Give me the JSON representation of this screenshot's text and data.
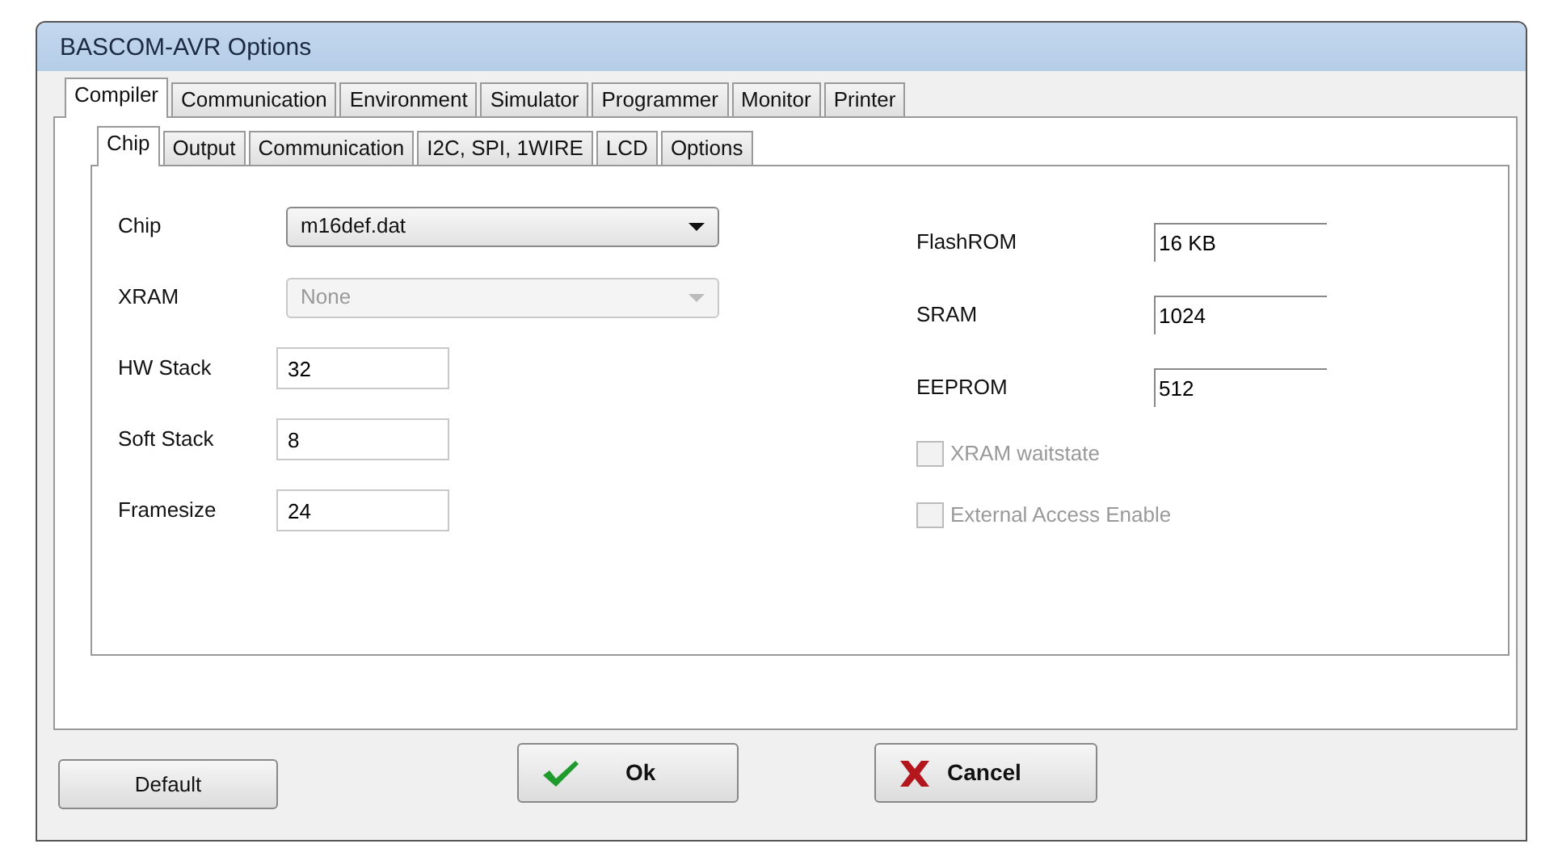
{
  "window": {
    "title": "BASCOM-AVR Options"
  },
  "tabs": [
    {
      "label": "Compiler",
      "selected": true
    },
    {
      "label": "Communication",
      "selected": false
    },
    {
      "label": "Environment",
      "selected": false
    },
    {
      "label": "Simulator",
      "selected": false
    },
    {
      "label": "Programmer",
      "selected": false
    },
    {
      "label": "Monitor",
      "selected": false
    },
    {
      "label": "Printer",
      "selected": false
    }
  ],
  "subtabs": [
    {
      "label": "Chip",
      "selected": true
    },
    {
      "label": "Output",
      "selected": false
    },
    {
      "label": "Communication",
      "selected": false
    },
    {
      "label": "I2C, SPI, 1WIRE",
      "selected": false
    },
    {
      "label": "LCD",
      "selected": false
    },
    {
      "label": "Options",
      "selected": false
    }
  ],
  "left_fields": [
    {
      "kind": "combo",
      "label": "Chip",
      "value": "m16def.dat",
      "disabled": false
    },
    {
      "kind": "combo",
      "label": "XRAM",
      "value": "None",
      "disabled": true
    },
    {
      "kind": "text",
      "label": "HW Stack",
      "value": "32"
    },
    {
      "kind": "text",
      "label": "Soft Stack",
      "value": "8"
    },
    {
      "kind": "text",
      "label": "Framesize",
      "value": "24"
    }
  ],
  "right_fields": [
    {
      "label": "FlashROM",
      "value": "16 KB"
    },
    {
      "label": "SRAM",
      "value": "1024"
    },
    {
      "label": "EEPROM",
      "value": "512"
    }
  ],
  "checkboxes": [
    {
      "label": "XRAM waitstate",
      "checked": false,
      "disabled": true
    },
    {
      "label": "External Access Enable",
      "checked": false,
      "disabled": true
    }
  ],
  "buttons": [
    {
      "kind": "default",
      "label": "Default"
    },
    {
      "kind": "ok",
      "label": "Ok"
    },
    {
      "kind": "cancel",
      "label": "Cancel"
    }
  ]
}
